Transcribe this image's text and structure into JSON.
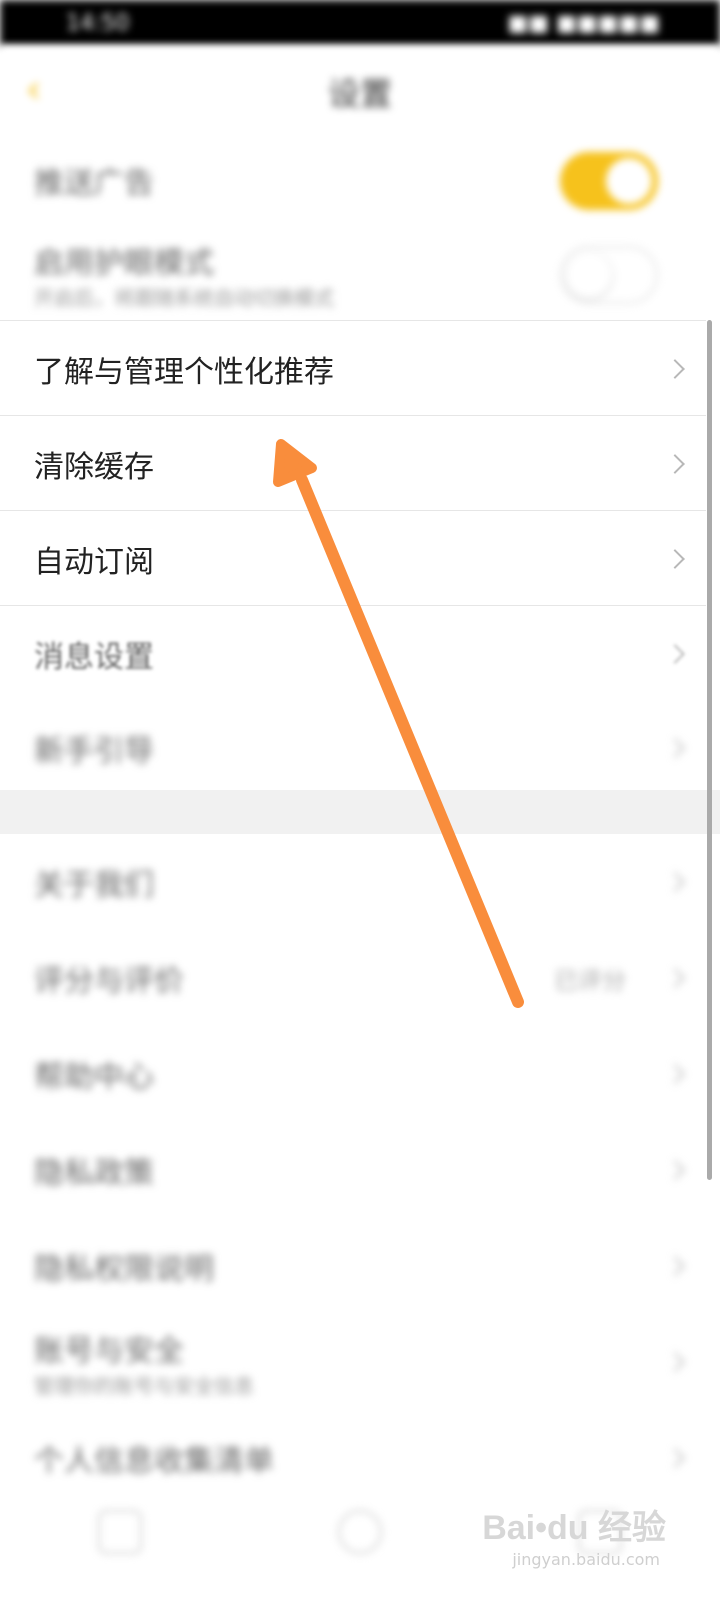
{
  "status_bar": {
    "time": "14:50",
    "right": "■■ ■■■■■"
  },
  "header": {
    "title": "设置"
  },
  "blurred_rows": [
    {
      "label": "推送广告"
    },
    {
      "label": "启用护眼模式",
      "sub": "开启后，将跟随系统自动切换模式"
    }
  ],
  "menu": [
    {
      "label": "了解与管理个性化推荐"
    },
    {
      "label": "清除缓存"
    },
    {
      "label": "自动订阅"
    },
    {
      "label": "消息设置"
    }
  ],
  "lower_rows": [
    {
      "label": "新手引导"
    },
    {
      "label": "关于我们"
    },
    {
      "label": "评分与评价",
      "right": "已评分"
    },
    {
      "label": "帮助中心"
    },
    {
      "label": "隐私政策"
    },
    {
      "label": "隐私权限说明"
    },
    {
      "label": "账号与安全",
      "sub": "管理你的账号与安全信息"
    },
    {
      "label": "个人信息收集清单"
    }
  ],
  "watermark": {
    "logo": "Bai•du 经验",
    "url": "jingyan.baidu.com"
  },
  "colors": {
    "accent": "#f6c21c",
    "arrow": "#f98d3c"
  }
}
